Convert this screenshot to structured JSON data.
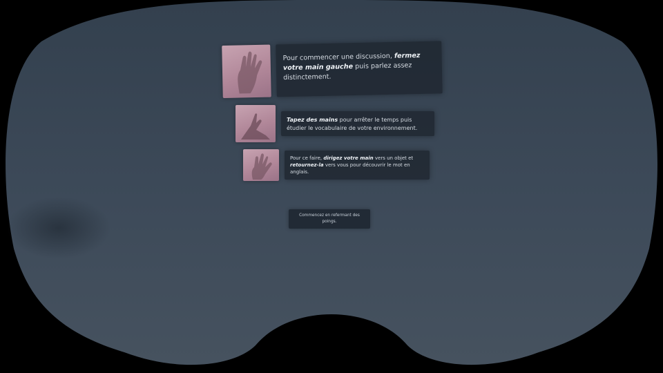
{
  "instructions": [
    {
      "id": "start-conversation",
      "thumbnail": "raised-hand-icon",
      "segments": [
        {
          "text": "Pour commencer une discussion, ",
          "emphasis": false
        },
        {
          "text": "fermez votre main gauche",
          "emphasis": true
        },
        {
          "text": " puis parlez assez distinctement.",
          "emphasis": false
        }
      ]
    },
    {
      "id": "pause-time",
      "thumbnail": "clapping-hands-icon",
      "segments": [
        {
          "text": "Tapez des mains",
          "emphasis": true
        },
        {
          "text": " pour arrêter le temps puis étudier le vocabulaire de votre environnement.",
          "emphasis": false
        }
      ]
    },
    {
      "id": "discover-word",
      "thumbnail": "pointing-hand-icon",
      "segments": [
        {
          "text": "Pour ce faire, ",
          "emphasis": false
        },
        {
          "text": "dirigez votre main",
          "emphasis": true
        },
        {
          "text": " vers un objet et ",
          "emphasis": false
        },
        {
          "text": "retournez-la",
          "emphasis": true
        },
        {
          "text": " vers vous pour découvrir le mot en anglais.",
          "emphasis": false
        }
      ]
    }
  ],
  "ok_button": {
    "label": "Commencez en refermant des poings."
  },
  "colors": {
    "background": "#000000",
    "scene": "#3a4756",
    "panel": "#1e2630",
    "panel_text": "#d7dde4",
    "thumbnail": "#b48a9c"
  }
}
